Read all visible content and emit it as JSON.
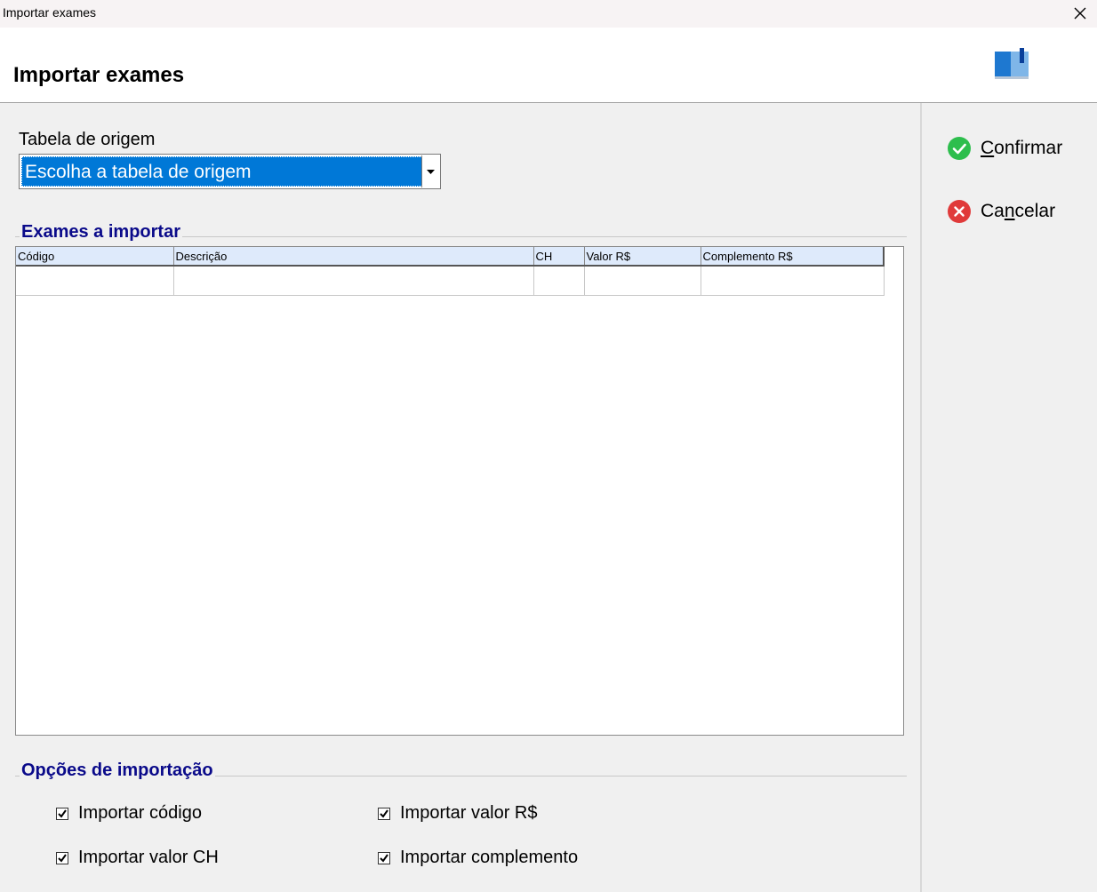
{
  "window": {
    "title": "Importar exames",
    "close_glyph": "✕"
  },
  "header": {
    "title": "Importar exames",
    "logo_icon": "book-icon"
  },
  "origem": {
    "label": "Tabela de origem",
    "selected": "Escolha a tabela de origem"
  },
  "exames": {
    "group_title": "Exames a importar",
    "columns": [
      "Código",
      "Descrição",
      "CH",
      "Valor R$",
      "Complemento R$"
    ],
    "rows": []
  },
  "opcoes": {
    "group_title": "Opções de importação",
    "items": [
      {
        "label": "Importar código",
        "checked": true
      },
      {
        "label": "Importar valor R$",
        "checked": true
      },
      {
        "label": "Importar valor CH",
        "checked": true
      },
      {
        "label": "Importar complemento",
        "checked": true
      }
    ]
  },
  "actions": {
    "confirm_label": "Confirmar",
    "cancel_label": "Cancelar",
    "confirm_color": "#2dbe4d",
    "cancel_color": "#e03a3a"
  }
}
